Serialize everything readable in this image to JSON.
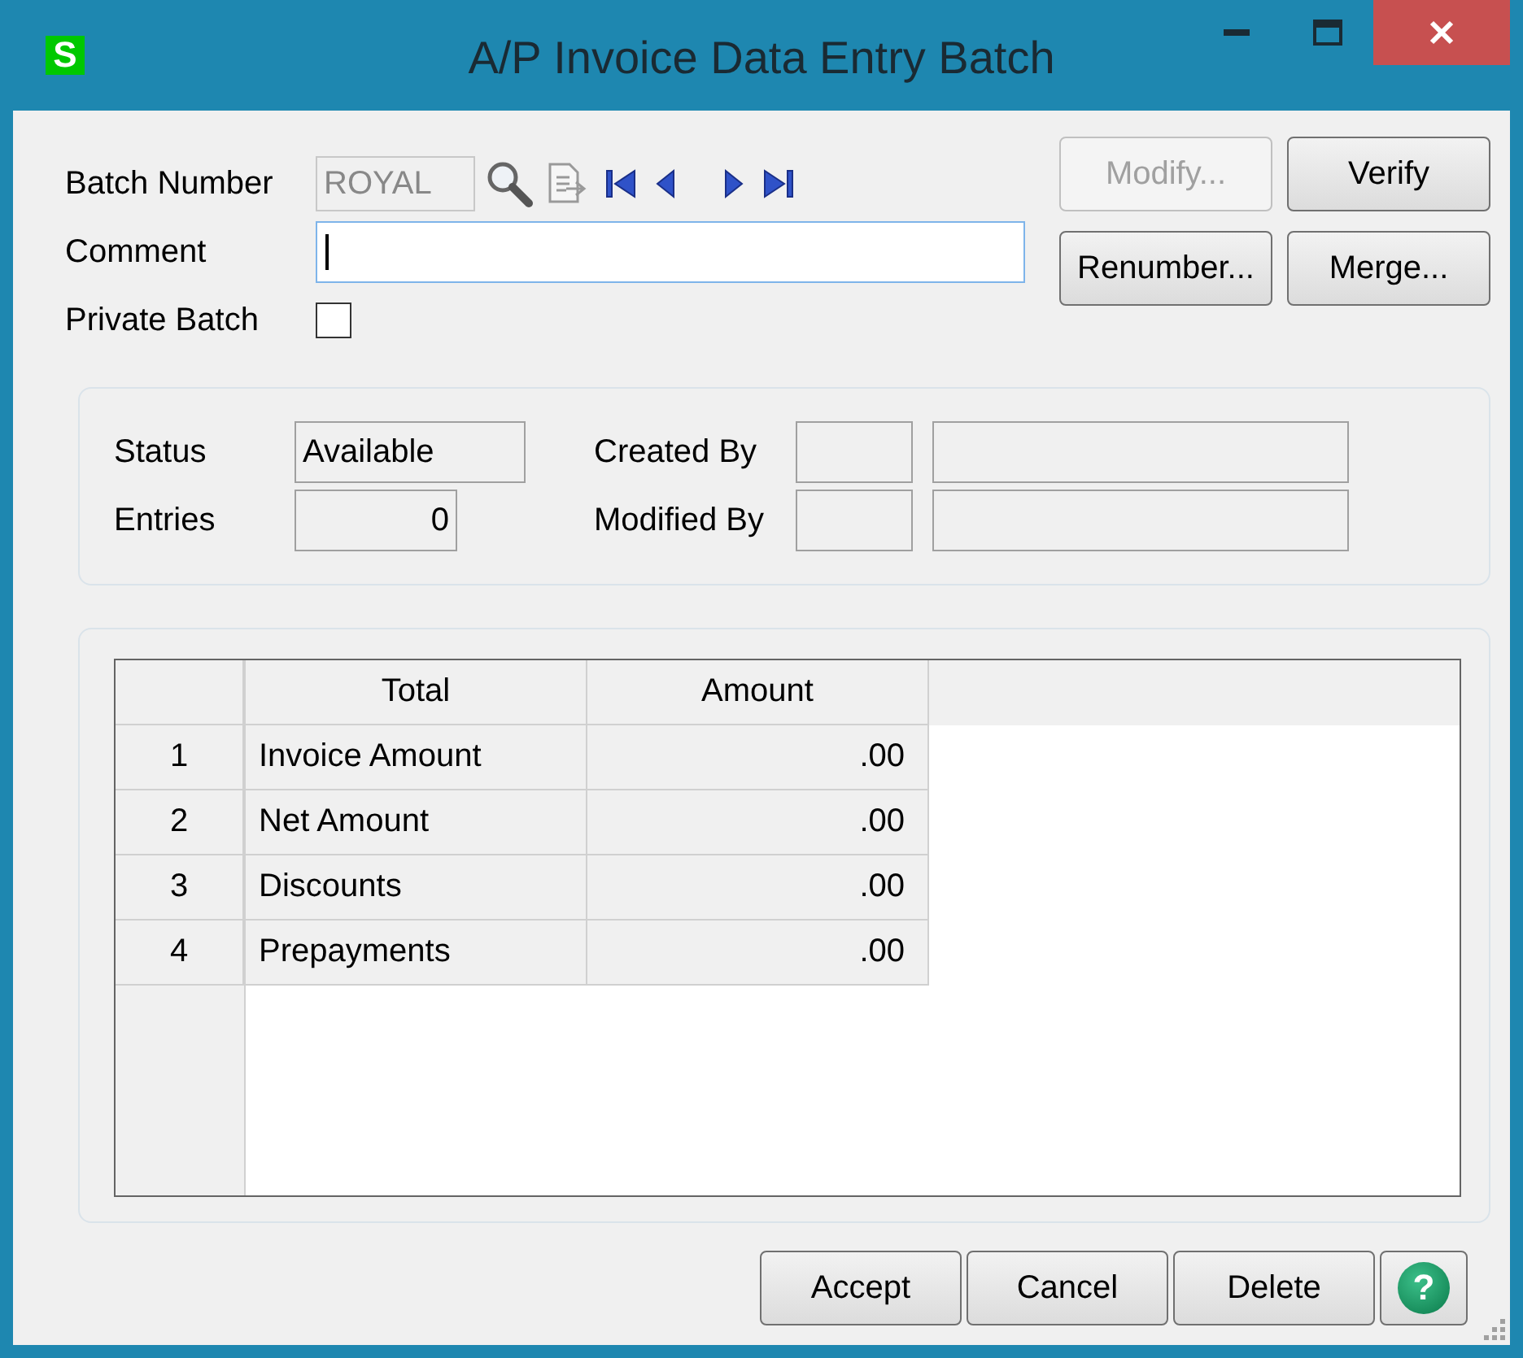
{
  "window": {
    "title": "A/P Invoice Data Entry Batch",
    "app_icon": "S"
  },
  "batch": {
    "label": "Batch Number",
    "value": "ROYAL"
  },
  "comment": {
    "label": "Comment",
    "focused": true
  },
  "private_batch": {
    "label": "Private Batch",
    "checked": false
  },
  "side_buttons": [
    {
      "label": "Modify...",
      "disabled": true
    },
    {
      "label": "Verify",
      "disabled": false
    },
    {
      "label": "Renumber...",
      "disabled": false
    },
    {
      "label": "Merge...",
      "disabled": false
    }
  ],
  "info": {
    "status": {
      "label": "Status",
      "value": "Available"
    },
    "entries": {
      "label": "Entries",
      "value": "0"
    },
    "created_by": {
      "label": "Created By"
    },
    "modified_by": {
      "label": "Modified By"
    }
  },
  "grid": {
    "columns": [
      "Total",
      "Amount"
    ],
    "rows": [
      {
        "number": "1",
        "total": "Invoice Amount",
        "amount": ".00"
      },
      {
        "number": "2",
        "total": "Net Amount",
        "amount": ".00"
      },
      {
        "number": "3",
        "total": "Discounts",
        "amount": ".00"
      },
      {
        "number": "4",
        "total": "Prepayments",
        "amount": ".00"
      }
    ]
  },
  "buttons": [
    {
      "label": "Accept"
    },
    {
      "label": "Cancel"
    },
    {
      "label": "Delete"
    }
  ],
  "help": {
    "label": "?"
  }
}
